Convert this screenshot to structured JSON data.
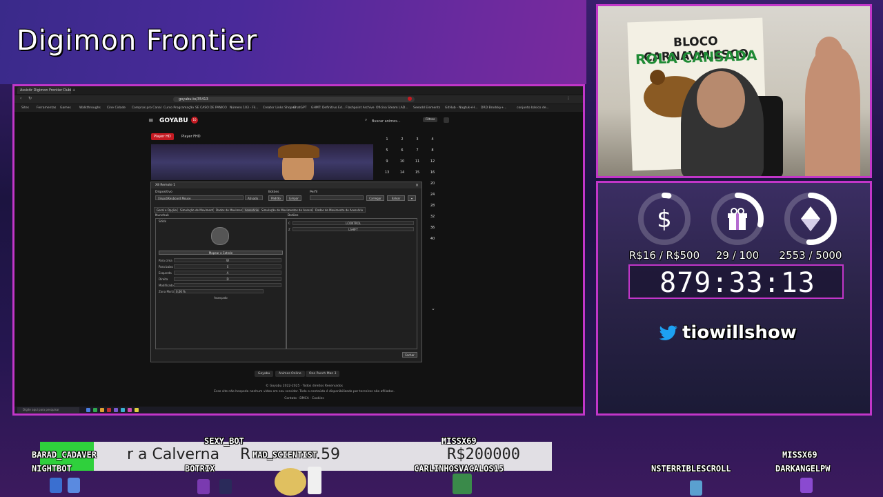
{
  "stream_title": "Digimon Frontier",
  "browser": {
    "tab_label": "Assistir Digimon Frontier Dublado",
    "url": "goyabu.to/35413",
    "bookmarks": [
      "Sites",
      "Ferramentas",
      "Games",
      "Walkthroughs",
      "Cine Cidade",
      "Compras pro Canal",
      "Curso Programação",
      "SE CASO DE PANICO",
      "Número 103 - Fil...",
      "Creator Links Shopee",
      "ChatGPT",
      "GHMT: Definitivo Ed...",
      "Flashpoint Archive",
      "Oficina Steam LAD...",
      "Seeadd Elements",
      "GitHub - Nagtuk+H...",
      "DRD Brodsky+...",
      "conjunto básico de..."
    ]
  },
  "site": {
    "logo": "GOYABU",
    "logo_badge": "10",
    "search_placeholder": "Buscar animes...",
    "filters_label": "Filtros",
    "player_hd": "Player HD",
    "player_fhd": "Player FHD",
    "episodes": [
      "1",
      "2",
      "3",
      "4",
      "5",
      "6",
      "7",
      "8",
      "9",
      "10",
      "11",
      "12",
      "13",
      "14",
      "15",
      "16",
      "20",
      "24",
      "28",
      "32",
      "36",
      "40"
    ],
    "footer_links": [
      "Goyabu",
      "Animes Online",
      "One Punch Man 3"
    ],
    "copyright": "© Goyabu 2022-2025 · Todos direitos Reservados",
    "disclaimer": "Esse site não hospeda nenhum vídeo em seu servidor. Todo o conteúdo é disponibilizado por terceiros não afiliados.",
    "legal": "Contato · DMCA · Cookies"
  },
  "dialog": {
    "title": "X8 Remote 1",
    "device_label": "Dispositivo",
    "device_value": "Xinput/Keyboard Mouse",
    "device_mode": "Ativado",
    "bindings_label": "Botões",
    "profile_label": "Perfil",
    "btn_padrao": "Padrão",
    "btn_limpar": "Limpar",
    "btn_carregar": "Carregar",
    "btn_salvar": "Salvar",
    "tabs": [
      "Geral e Opções",
      "Simulação de Movimentos",
      "Dados de Movimento",
      "Acessórios",
      "Simulação de Movimentos de Acessório",
      "Dados de Movimento de Acessório"
    ],
    "left_section": "Nunchuk",
    "right_section": "Botões",
    "stick_label": "Stick",
    "map_button": "Mapear o Cotrole",
    "rows": [
      {
        "label": "Para cima",
        "value": "W"
      },
      {
        "label": "Para baixo",
        "value": "S"
      },
      {
        "label": "Esquerda",
        "value": "A"
      },
      {
        "label": "Direita",
        "value": "D"
      },
      {
        "label": "Modificador",
        "value": ""
      },
      {
        "label": "Zona Morta",
        "value": "0,00 %"
      }
    ],
    "advanced": "Avançado",
    "right_rows": [
      {
        "label": "C",
        "value": "LCONTROL"
      },
      {
        "label": "Z",
        "value": "LSHIFT"
      }
    ],
    "close_button": "Fechar"
  },
  "taskbar": {
    "search_placeholder": "Digite aqui para pesquisar"
  },
  "stats": {
    "goal1_icon": "$",
    "goal1": "R$16 / R$500",
    "goal2": "29 / 100",
    "goal3": "2553 / 5000",
    "goal1_progress": 0.03,
    "goal2_progress": 0.29,
    "goal3_progress": 0.51,
    "timer": "879:33:13",
    "twitter_handle": "tiowillshow"
  },
  "webcam": {
    "banner_line1": "BLOCO CARNAVALESCO",
    "banner_line2": "ROLA CANSADA"
  },
  "ticker": {
    "text": "r a Calverna",
    "amount_name": "R",
    "amount": "R$200000",
    "small_count": ".59"
  },
  "nicknames": [
    {
      "id": "sexy-bot",
      "text": "SEXY_BOT"
    },
    {
      "id": "barad-cadaver",
      "text": "BARAD_CADAVER"
    },
    {
      "id": "nightbot",
      "text": "NIGHTBOT"
    },
    {
      "id": "botrix",
      "text": "BOTRIX"
    },
    {
      "id": "mad-scientist",
      "text": "MAD_SCIENTIST"
    },
    {
      "id": "missx69-a",
      "text": "MISSX69"
    },
    {
      "id": "carlinhosvacalos15",
      "text": "CARLINHOSVACALOS15"
    },
    {
      "id": "missx69-b",
      "text": "MISSX69"
    },
    {
      "id": "nsterriblescroll",
      "text": "NSTERRIBLESCROLL"
    },
    {
      "id": "darkangelpw",
      "text": "DARKANGELPW"
    }
  ],
  "colors": {
    "accent": "#c236c9",
    "goyabu_red": "#c41a22",
    "ticker_green": "#2fd03c"
  }
}
